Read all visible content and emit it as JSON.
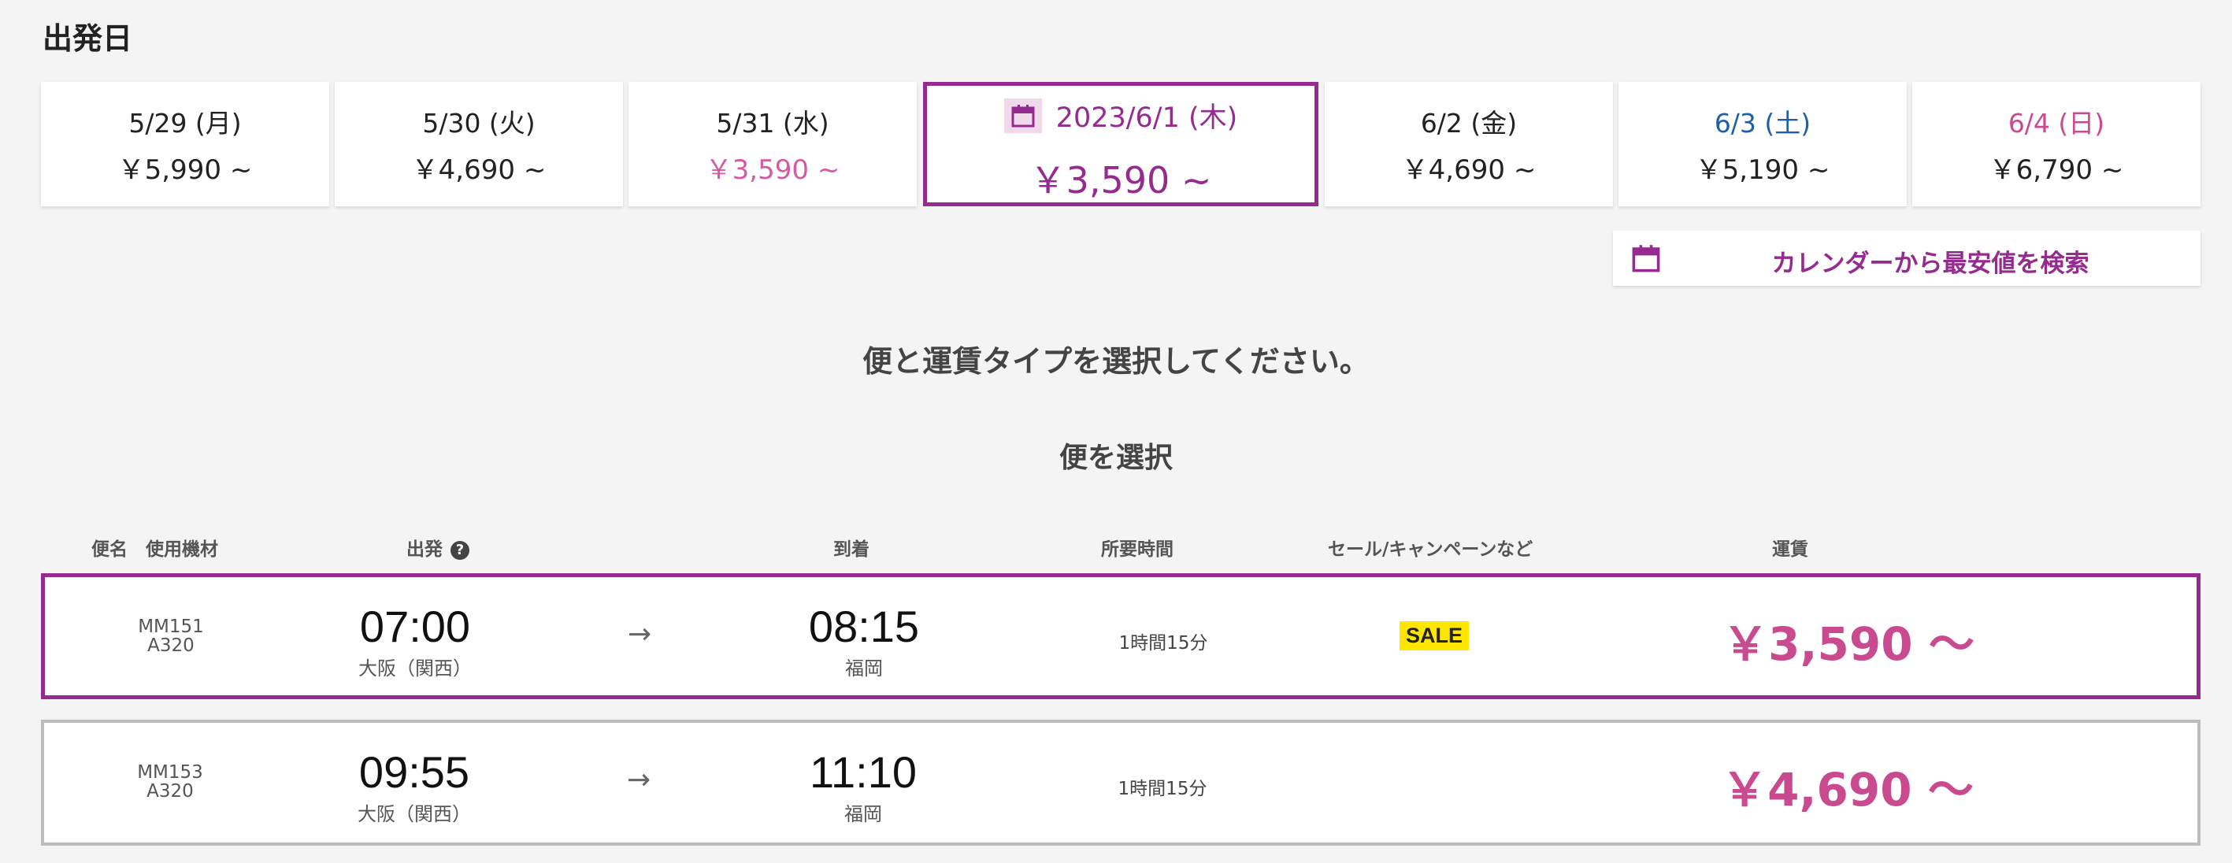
{
  "section_title": "出発日",
  "dates": [
    {
      "label": "5/29 (月)",
      "price": "￥5,990 ~"
    },
    {
      "label": "5/30 (火)",
      "price": "￥4,690 ~"
    },
    {
      "label": "5/31 (水)",
      "price": "￥3,590 ~"
    },
    {
      "label": "2023/6/1 (木)",
      "price": "￥3,590 ~"
    },
    {
      "label": "6/2 (金)",
      "price": "￥4,690 ~"
    },
    {
      "label": "6/3 (土)",
      "price": "￥5,190 ~"
    },
    {
      "label": "6/4 (日)",
      "price": "￥6,790 ~"
    }
  ],
  "calendar_search_label": "カレンダーから最安値を検索",
  "instruction": "便と運賃タイプを選択してください。",
  "subheading": "便を選択",
  "columns": {
    "flight_aircraft": "便名　使用機材",
    "departure": "出発",
    "help": "?",
    "arrival": "到着",
    "duration": "所要時間",
    "sale": "セール/キャンペーンなど",
    "fare": "運賃"
  },
  "flights": [
    {
      "number": "MM151",
      "aircraft": "A320",
      "dep_time": "07:00",
      "dep_city": "大阪（関西）",
      "arrow": "→",
      "arr_time": "08:15",
      "arr_city": "福岡",
      "duration": "1時間15分",
      "sale": "SALE",
      "price": "￥3,590 〜"
    },
    {
      "number": "MM153",
      "aircraft": "A320",
      "dep_time": "09:55",
      "dep_city": "大阪（関西）",
      "arrow": "→",
      "arr_time": "11:10",
      "arr_city": "福岡",
      "duration": "1時間15分",
      "sale": "",
      "price": "￥4,690 〜"
    }
  ],
  "colors": {
    "brand": "#952b8f",
    "price_pink": "#c94a8f",
    "saturday": "#1f5fa8",
    "sale_badge": "#fee600"
  },
  "icons": [
    "calendar-icon",
    "help-icon",
    "arrow-right-icon"
  ]
}
